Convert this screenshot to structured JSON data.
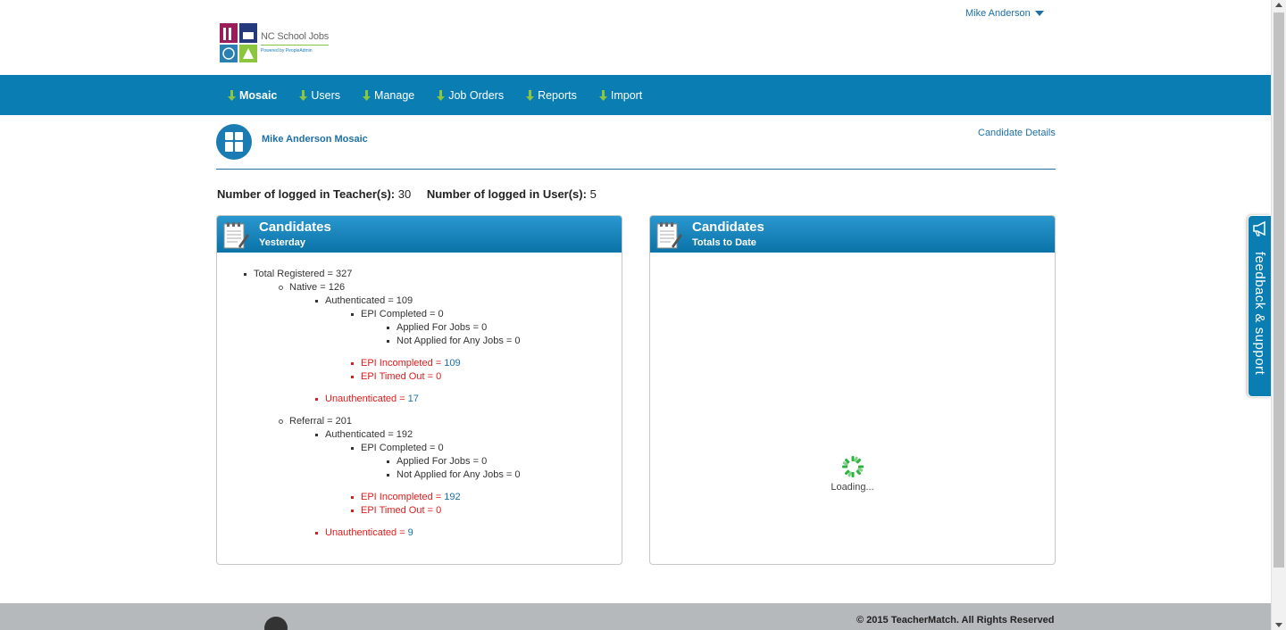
{
  "header": {
    "logo_name": "NC School Jobs",
    "logo_powered": "Powered by PeopleAdmin",
    "user_name": "Mike Anderson"
  },
  "nav": {
    "items": [
      {
        "label": "Mosaic",
        "active": true
      },
      {
        "label": "Users"
      },
      {
        "label": "Manage"
      },
      {
        "label": "Job Orders"
      },
      {
        "label": "Reports"
      },
      {
        "label": "Import"
      }
    ]
  },
  "page": {
    "title": "Mike Anderson Mosaic",
    "candidate_details_link": "Candidate Details"
  },
  "counts": {
    "teachers_label": "Number of logged in Teacher(s):",
    "teachers_value": "30",
    "users_label": "Number of logged in User(s):",
    "users_value": "5"
  },
  "panel_yesterday": {
    "title": "Candidates",
    "subtitle": "Yesterday",
    "tree": {
      "total": "Total Registered = 327",
      "native": "Native = 126",
      "native_auth": "Authenticated = 109",
      "native_epi_completed": "EPI Completed = 0",
      "native_applied": "Applied For Jobs = 0",
      "native_not_applied": "Not Applied for Any Jobs = 0",
      "native_epi_incomplete_label": "EPI Incompleted = ",
      "native_epi_incomplete_value": "109",
      "native_epi_timed_out": "EPI Timed Out = 0",
      "native_unauth_label": "Unauthenticated = ",
      "native_unauth_value": "17",
      "referral": "Referral = 201",
      "referral_auth": "Authenticated = 192",
      "referral_epi_completed": "EPI Completed = 0",
      "referral_applied": "Applied For Jobs = 0",
      "referral_not_applied": "Not Applied for Any Jobs = 0",
      "referral_epi_incomplete_label": "EPI Incompleted = ",
      "referral_epi_incomplete_value": "192",
      "referral_epi_timed_out": "EPI Timed Out = 0",
      "referral_unauth_label": "Unauthenticated = ",
      "referral_unauth_value": "9"
    }
  },
  "panel_totals": {
    "title": "Candidates",
    "subtitle": "Totals to Date",
    "loading_text": "Loading..."
  },
  "feedback": {
    "label": "feedback & support"
  },
  "footer": {
    "copyright": "© 2015 TeacherMatch. All Rights Reserved"
  },
  "colors": {
    "brand_blue": "#0a7eb3",
    "link_blue": "#1d6fa5",
    "alert_red": "#e01b1b",
    "nav_arrow_green": "#8cc63f",
    "spinner_green": "#2bb33c",
    "footer_gray": "#b6b9bc"
  },
  "icons": {
    "user_caret": "caret-down-icon",
    "nav_arrow": "arrow-down-icon",
    "mosaic": "mosaic-grid-icon",
    "panel": "document-pencil-icon",
    "loading": "spinner-icon",
    "feedback": "megaphone-icon"
  }
}
